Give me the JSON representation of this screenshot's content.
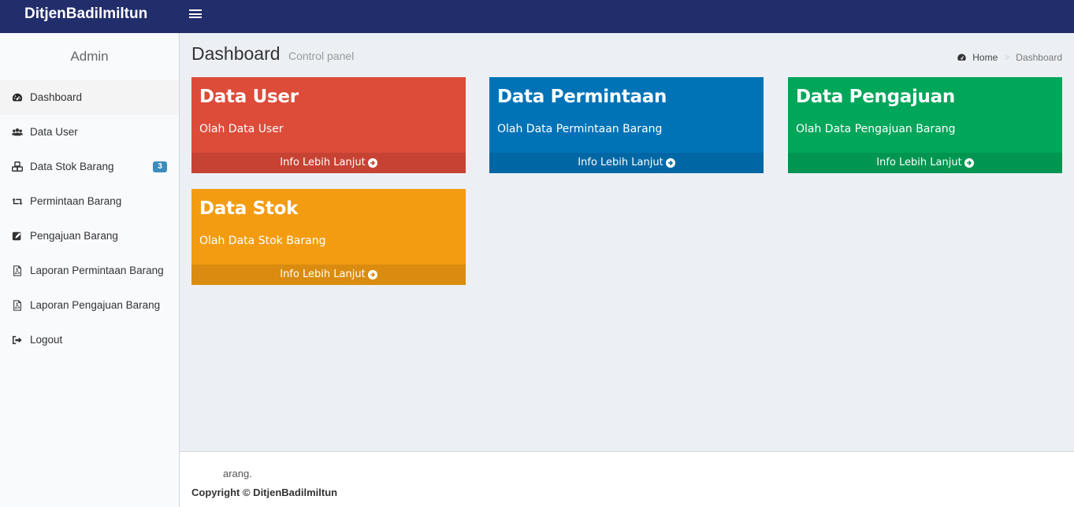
{
  "header": {
    "brand": "DitjenBadilmiltun"
  },
  "sidebar": {
    "user": "Admin",
    "items": [
      {
        "label": "Dashboard",
        "icon": "dashboard-icon"
      },
      {
        "label": "Data User",
        "icon": "users-icon"
      },
      {
        "label": "Data Stok Barang",
        "icon": "cubes-icon",
        "badge": "3"
      },
      {
        "label": "Permintaan Barang",
        "icon": "retweet-icon"
      },
      {
        "label": "Pengajuan Barang",
        "icon": "edit-icon"
      },
      {
        "label": "Laporan Permintaan Barang",
        "icon": "pdf-icon"
      },
      {
        "label": "Laporan Pengajuan Barang",
        "icon": "pdf-icon"
      },
      {
        "label": "Logout",
        "icon": "sign-out-icon"
      }
    ]
  },
  "content": {
    "title": "Dashboard",
    "subtitle": "Control panel",
    "breadcrumb": {
      "home": "Home",
      "current": "Dashboard"
    },
    "boxes": [
      {
        "title": "Data User",
        "desc": "Olah Data User",
        "link": "Info Lebih Lanjut",
        "color": "#dd4b39"
      },
      {
        "title": "Data Permintaan",
        "desc": "Olah Data Permintaan Barang",
        "link": "Info Lebih Lanjut",
        "color": "#0073b7"
      },
      {
        "title": "Data Pengajuan",
        "desc": "Olah Data Pengajuan Barang",
        "link": "Info Lebih Lanjut",
        "color": "#00a65a"
      },
      {
        "title": "Data Stok",
        "desc": "Olah Data Stok Barang",
        "link": "Info Lebih Lanjut",
        "color": "#f39c12"
      }
    ]
  },
  "footer": {
    "text": "arang.",
    "copyright": "Copyright © DitjenBadilmiltun"
  }
}
